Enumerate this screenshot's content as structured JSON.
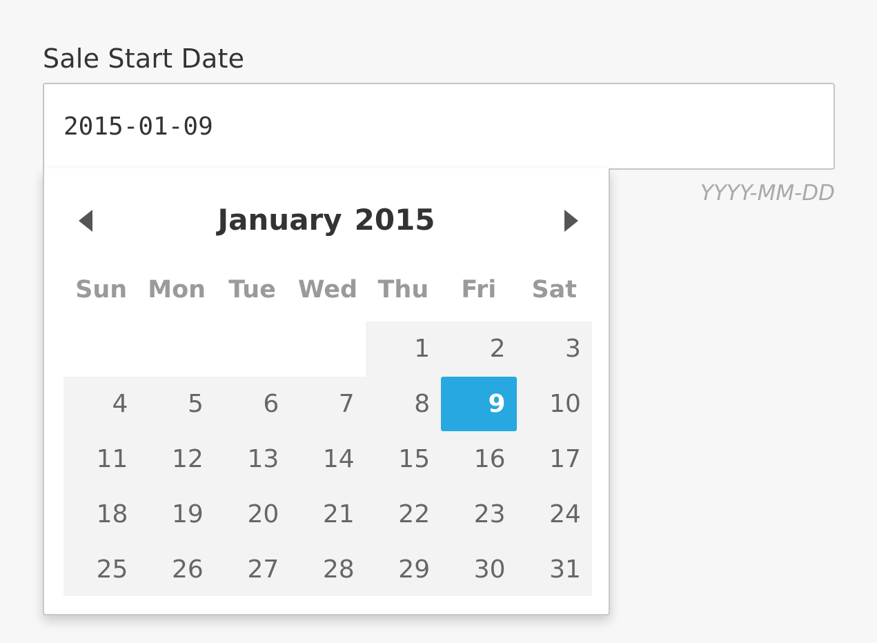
{
  "field": {
    "label": "Sale Start Date",
    "value": "2015-01-09",
    "format_hint": "YYYY-MM-DD"
  },
  "datepicker": {
    "month": "January",
    "year": "2015",
    "weekdays": [
      "Sun",
      "Mon",
      "Tue",
      "Wed",
      "Thu",
      "Fri",
      "Sat"
    ],
    "weeks": [
      [
        "",
        "",
        "",
        "",
        "1",
        "2",
        "3"
      ],
      [
        "4",
        "5",
        "6",
        "7",
        "8",
        "9",
        "10"
      ],
      [
        "11",
        "12",
        "13",
        "14",
        "15",
        "16",
        "17"
      ],
      [
        "18",
        "19",
        "20",
        "21",
        "22",
        "23",
        "24"
      ],
      [
        "25",
        "26",
        "27",
        "28",
        "29",
        "30",
        "31"
      ]
    ],
    "selected_day": "9",
    "colors": {
      "selected": "#27a8e0",
      "month_background": "#f3f3f3"
    },
    "icons": {
      "prev": "triangle-left-icon",
      "next": "triangle-right-icon"
    }
  }
}
